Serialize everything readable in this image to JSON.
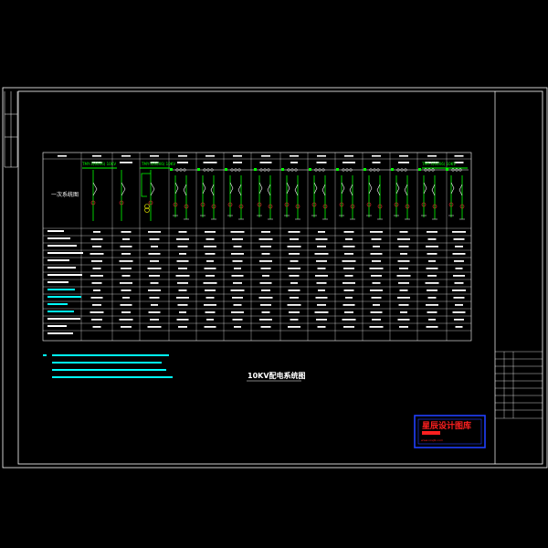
{
  "drawing": {
    "title": "10KV配电系统图",
    "single_line_label": "一次系统图",
    "bus_labels": [
      "TMY-3(60X6) 10KV",
      "TMY-3(60X6) 10KV",
      "TMY-3(60X6) 10KV"
    ],
    "colors": {
      "frame": "#ffffff",
      "bus": "#00ff00",
      "table_text": "#ffffff",
      "stamp": "#ff2020",
      "stamp_border": "#2040ff",
      "note": "#00ffff"
    }
  },
  "stamp": {
    "title": "星辰设计图库",
    "subtitle": "www.xcsjtk.com"
  }
}
